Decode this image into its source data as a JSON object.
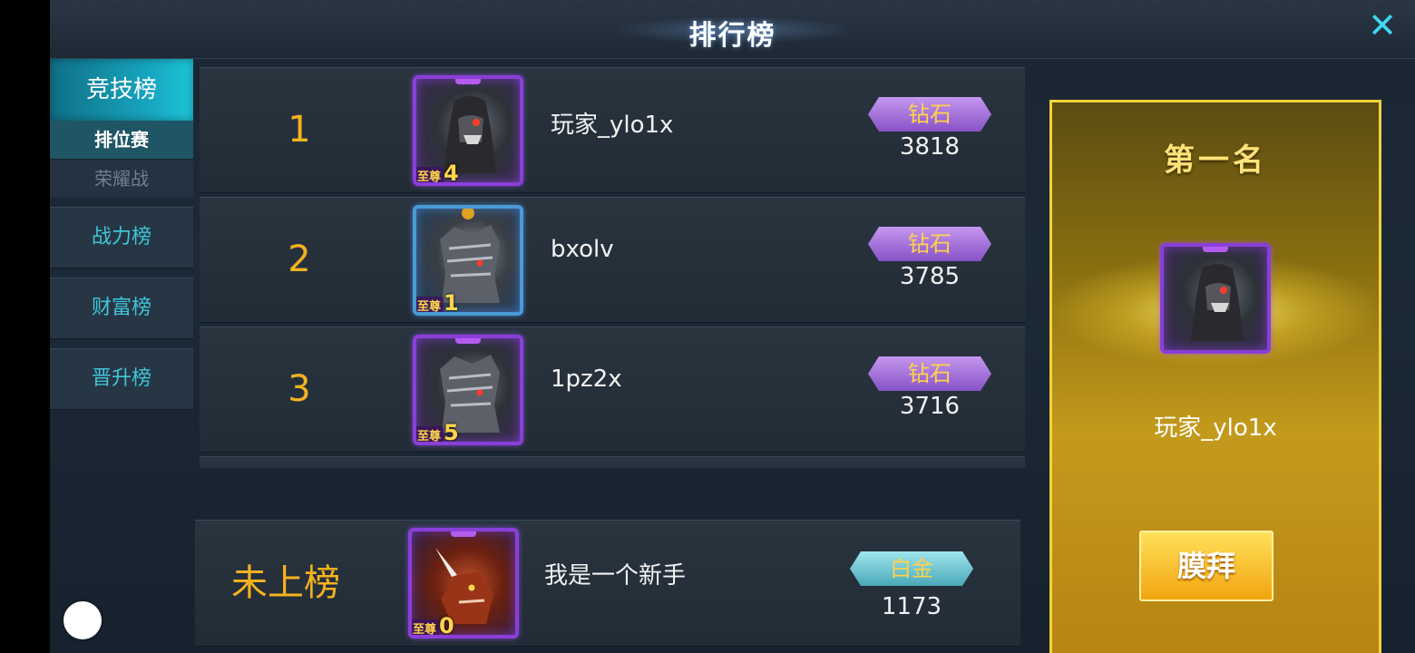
{
  "header": {
    "title": "排行榜"
  },
  "sidebar": {
    "main_tab": "竞技榜",
    "sub_tabs": [
      {
        "label": "排位赛",
        "active": true
      },
      {
        "label": "荣耀战",
        "active": false
      }
    ],
    "tabs": [
      "战力榜",
      "财富榜",
      "晋升榜"
    ]
  },
  "leaderboard": [
    {
      "rank": "1",
      "name": "玩家_ylo1x",
      "tier_label": "至尊",
      "tier_num": "4",
      "badge": "钻石",
      "score": "3818",
      "frame": "purple"
    },
    {
      "rank": "2",
      "name": "bxolv",
      "tier_label": "至尊",
      "tier_num": "1",
      "badge": "钻石",
      "score": "3785",
      "frame": "blue"
    },
    {
      "rank": "3",
      "name": "1pz2x",
      "tier_label": "至尊",
      "tier_num": "5",
      "badge": "钻石",
      "score": "3716",
      "frame": "purple"
    }
  ],
  "self": {
    "rank": "未上榜",
    "name": "我是一个新手",
    "tier_label": "至尊",
    "tier_num": "0",
    "badge": "白金",
    "score": "1173"
  },
  "champion": {
    "title": "第一名",
    "name": "玩家_ylo1x",
    "button": "膜拜"
  },
  "colors": {
    "rank_gold": "#f4b21f",
    "accent_cyan": "#3fc6d8",
    "diamond_badge": "#8752c7",
    "platinum_badge": "#4aa8b8"
  }
}
